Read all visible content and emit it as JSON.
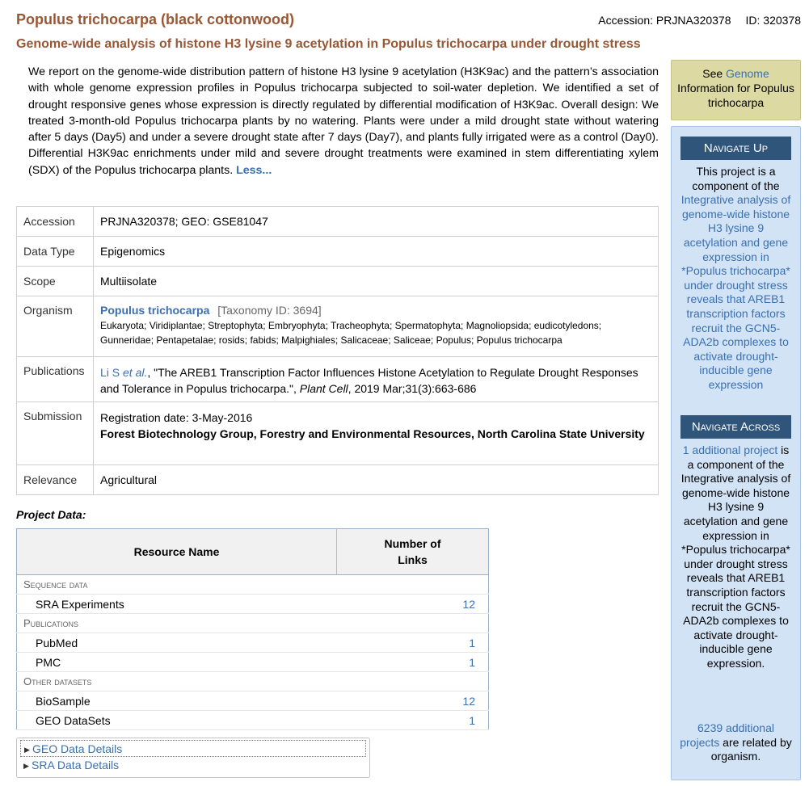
{
  "header": {
    "title": "Populus trichocarpa (black cottonwood)",
    "accession": "Accession: PRJNA320378",
    "id": "ID: 320378",
    "subtitle": "Genome-wide analysis of histone H3 lysine 9 acetylation in Populus trichocarpa under drought stress"
  },
  "abstract": {
    "text": "We report on the genome-wide distribution pattern of histone H3 lysine 9 acetylation (H3K9ac) and the pattern’s association with whole genome expression profiles in Populus trichocarpa subjected to soil-water depletion. We identified a set of drought responsive genes whose expression is directly regulated by differential modification of H3K9ac. Overall design: We treated 3-month-old Populus trichocarpa plants by no watering. Plants were under a mild drought state without watering after 5 days (Day5) and under a severe drought state after 7 days (Day7), and plants fully irrigated were as a control (Day0). Differential H3K9ac enrichments under mild and severe drought treatments were examined in stem differentiating xylem (SDX) of the Populus trichocarpa plants.",
    "less_link": "Less..."
  },
  "info": {
    "accession_label": "Accession",
    "accession_value": "PRJNA320378; GEO: GSE81047",
    "datatype_label": "Data Type",
    "datatype_value": "Epigenomics",
    "scope_label": "Scope",
    "scope_value": "Multiisolate",
    "organism_label": "Organism",
    "organism_name": "Populus trichocarpa",
    "organism_taxid": "[Taxonomy ID: 3694]",
    "organism_lineage": "Eukaryota; Viridiplantae; Streptophyta; Embryophyta; Tracheophyta; Spermatophyta; Magnoliopsida; eudicotyledons; Gunneridae; Pentapetalae; rosids; fabids; Malpighiales; Salicaceae; Saliceae; Populus; Populus trichocarpa",
    "publications_label": "Publications",
    "pub_authors": "Li S",
    "pub_etal": "et al.",
    "pub_title": ", \"The AREB1 Transcription Factor Influences Histone Acetylation to Regulate Drought Responses and Tolerance in Populus trichocarpa.\", ",
    "pub_journal": "Plant Cell",
    "pub_citation": ", 2019 Mar;31(3):663-686",
    "submission_label": "Submission",
    "submission_date": "Registration date: 3-May-2016",
    "submission_org": "Forest Biotechnology Group, Forestry and Environmental Resources, North Carolina State University",
    "relevance_label": "Relevance",
    "relevance_value": "Agricultural"
  },
  "project_data": {
    "label": "Project Data:",
    "col_resource": "Resource Name",
    "col_links": "Number of Links",
    "sections": [
      {
        "name": "Sequence data",
        "rows": [
          {
            "name": "SRA Experiments",
            "count": "12"
          }
        ]
      },
      {
        "name": "Publications",
        "rows": [
          {
            "name": "PubMed",
            "count": "1"
          },
          {
            "name": "PMC",
            "count": "1"
          }
        ]
      },
      {
        "name": "Other datasets",
        "rows": [
          {
            "name": "BioSample",
            "count": "12"
          },
          {
            "name": "GEO DataSets",
            "count": "1"
          }
        ]
      }
    ]
  },
  "details": {
    "geo": "GEO Data Details",
    "sra": "SRA Data Details"
  },
  "sidebar": {
    "see_prefix": "See ",
    "see_link": "Genome",
    "see_suffix": "Information for Populus trichocarpa",
    "nav_up_title": "Navigate Up",
    "nav_up_prefix": "This project is a component of the ",
    "nav_up_link": "Integrative analysis of genome-wide histone H3 lysine 9 acetylation and gene expression in *Populus trichocarpa* under drought stress reveals that AREB1 transcription factors recruit the GCN5-ADA2b complexes to activate drought-inducible gene expression",
    "nav_across_title": "Navigate Across",
    "nav_across_link": "1 additional project",
    "nav_across_text": " is a component of the Integrative analysis of genome-wide histone H3 lysine 9 acetylation and gene expression in *Populus trichocarpa* under drought stress reveals that AREB1 transcription factors recruit the GCN5-ADA2b complexes to activate drought-inducible gene expression.",
    "related_link": "6239 additional projects",
    "related_text": " are related by organism."
  },
  "colors": {
    "title": "#985735",
    "link": "#3a6fb0",
    "nav_header": "#30557a",
    "sidebar_bg": "#d2e3f6",
    "see_box_bg": "#dcd9a3"
  }
}
